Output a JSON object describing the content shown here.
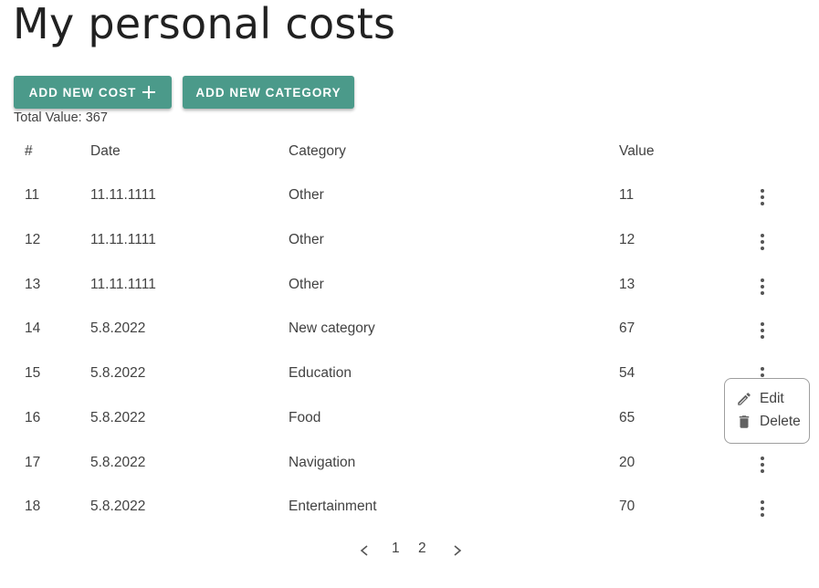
{
  "page": {
    "title": "My personal costs"
  },
  "toolbar": {
    "add_cost_label": "ADD NEW COST",
    "add_category_label": "ADD NEW CATEGORY"
  },
  "summary": {
    "total_label": "Total Value: ",
    "total_value": "367"
  },
  "table": {
    "headers": [
      "#",
      "Date",
      "Category",
      "Value"
    ],
    "rows": [
      {
        "num": "11",
        "date": "11.11.1111",
        "category": "Other",
        "value": "11"
      },
      {
        "num": "12",
        "date": "11.11.1111",
        "category": "Other",
        "value": "12"
      },
      {
        "num": "13",
        "date": "11.11.1111",
        "category": "Other",
        "value": "13"
      },
      {
        "num": "14",
        "date": "5.8.2022",
        "category": "New category",
        "value": "67"
      },
      {
        "num": "15",
        "date": "5.8.2022",
        "category": "Education",
        "value": "54"
      },
      {
        "num": "16",
        "date": "5.8.2022",
        "category": "Food",
        "value": "65"
      },
      {
        "num": "17",
        "date": "5.8.2022",
        "category": "Navigation",
        "value": "20"
      },
      {
        "num": "18",
        "date": "5.8.2022",
        "category": "Entertainment",
        "value": "70"
      }
    ]
  },
  "context_menu": {
    "edit_label": "Edit",
    "delete_label": "Delete"
  },
  "pagination": {
    "pages": [
      "1",
      "2"
    ]
  },
  "colors": {
    "button": "#4b9a8a",
    "text": "#424242"
  }
}
